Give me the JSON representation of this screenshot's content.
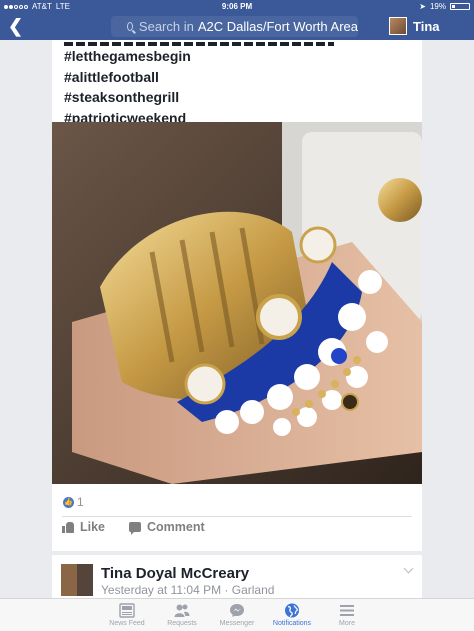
{
  "status_bar": {
    "carrier": "AT&T",
    "network": "LTE",
    "time": "9:06 PM",
    "battery": "19%"
  },
  "nav": {
    "search_placeholder": "Search in",
    "search_scope": "A2C Dallas/Fort Worth Area",
    "user_name": "Tina"
  },
  "post": {
    "hashtags": [
      "#letthegamesbegin",
      "#alittlefootball",
      "#steaksonthegrill",
      "#patrioticweekend"
    ],
    "photo_description": "gold american flag cuff with navy and white medallion bracelets and beaded stacks",
    "reaction_count": "1",
    "like_label": "Like",
    "comment_label": "Comment"
  },
  "next_post": {
    "author": "Tina Doyal McCreary",
    "time": "Yesterday at 11:04 PM",
    "separator": "·",
    "location": "Garland"
  },
  "tab_bar": [
    {
      "label": "News Feed",
      "icon": "news-feed-icon",
      "active": false
    },
    {
      "label": "Requests",
      "icon": "requests-icon",
      "active": false
    },
    {
      "label": "Messenger",
      "icon": "messenger-icon",
      "active": false
    },
    {
      "label": "Notifications",
      "icon": "globe-icon",
      "active": true
    },
    {
      "label": "More",
      "icon": "hamburger-icon",
      "active": false
    }
  ],
  "colors": {
    "brand": "#3b5998",
    "active_tab": "#3b73d6"
  }
}
